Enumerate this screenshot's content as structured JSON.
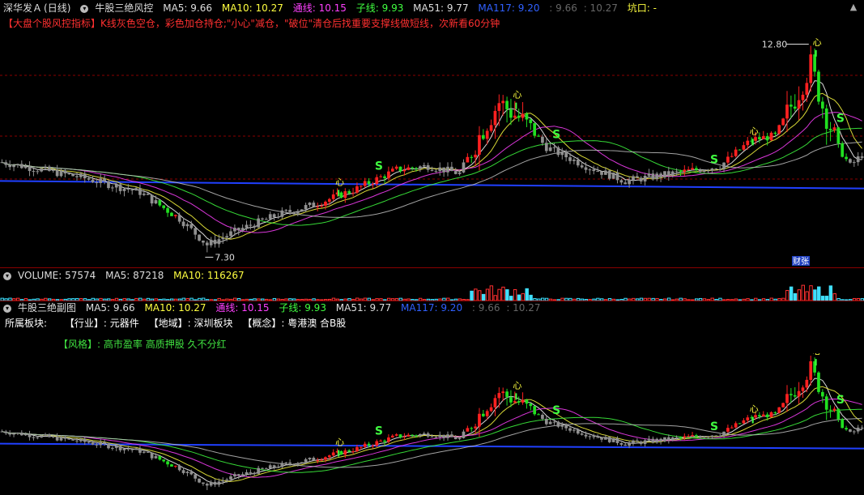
{
  "header": {
    "stock_name": "深华发Ａ",
    "period": "(日线)",
    "indicator": "牛股三绝风控",
    "ma5": "MA5: 9.66",
    "ma10": "MA10: 10.27",
    "tongxian": "通线: 10.15",
    "zixian": "子线: 9.93",
    "ma51": "MA51: 9.77",
    "ma117": "MA117: 9.20",
    "extra1": ": 9.66",
    "extra2": ": 10.27",
    "kengkou": "坑口: -"
  },
  "notice": "【大盘个股风控指标】K线灰色空仓，彩色加仓持仓;\"小心\"减仓，\"破位\"清仓后找重要支撑线做短线，次新看60分钟",
  "main_chart": {
    "high_label": "12.80",
    "low_label": "7.30",
    "badge": "财张"
  },
  "volume_bar": {
    "label": "VOLUME: 57574",
    "ma5": "MA5: 87218",
    "ma10": "MA10: 116267"
  },
  "sub_header": {
    "indicator": "牛股三绝副图",
    "ma5": "MA5: 9.66",
    "ma10": "MA10: 10.27",
    "tongxian": "通线: 10.15",
    "zixian": "子线: 9.93",
    "ma51": "MA51: 9.77",
    "ma117": "MA117: 9.20",
    "extra1": ": 9.66",
    "extra2": ": 10.27"
  },
  "info": {
    "board_label": "所属板块:",
    "industry_key": "【行业】:",
    "industry_val": "元器件",
    "region_key": "【地域】:",
    "region_val": "深圳板块",
    "concept_key": "【概念】:",
    "concept_val": "粤港澳 合B股",
    "style_key": "【风格】:",
    "style_val": "高市盈率 高质押股 久不分红"
  },
  "colors": {
    "up": "#ff2020",
    "down": "#20e020",
    "gray": "#909090",
    "ma117": "#2040ff",
    "tongxian": "#ff40ff",
    "zixian": "#40ff40"
  },
  "markers": {
    "s": "S",
    "xin": "心"
  }
}
